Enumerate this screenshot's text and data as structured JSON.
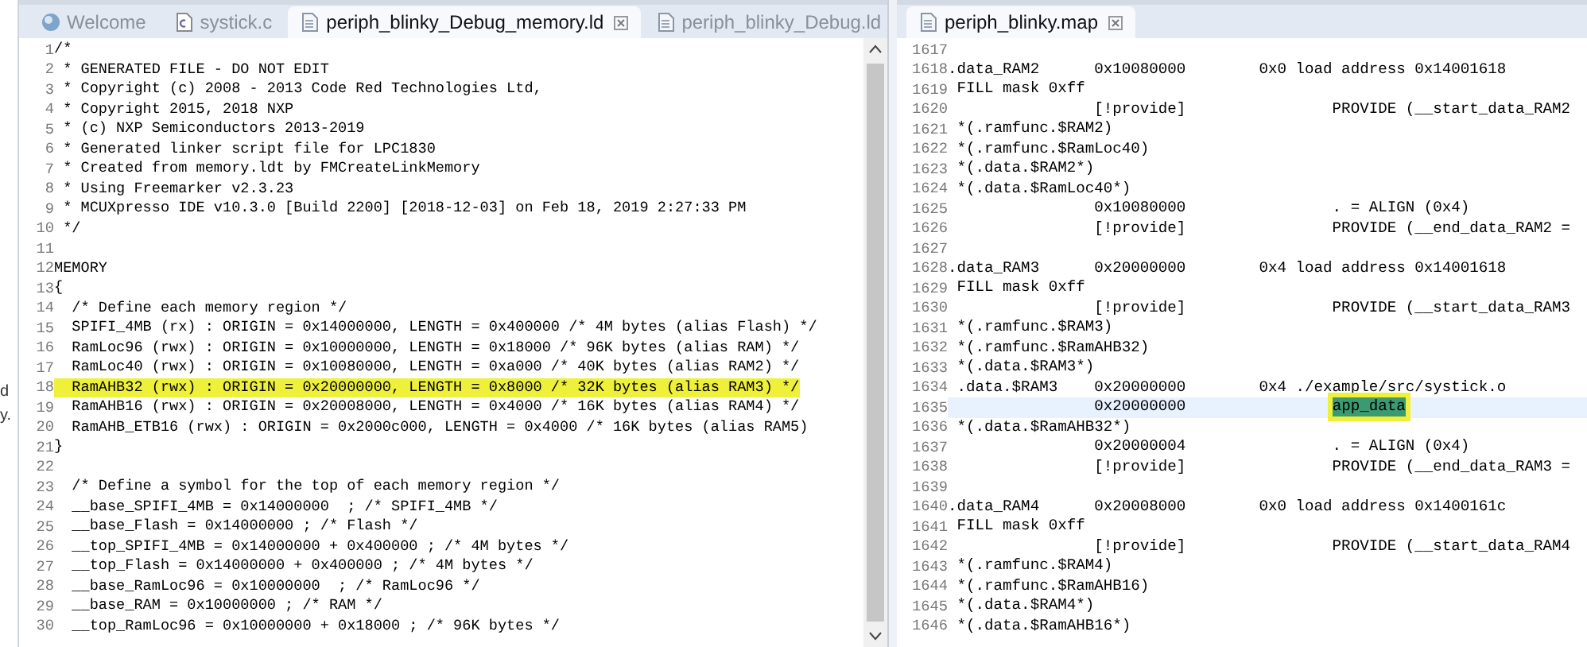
{
  "side_panel": {
    "lines": [
      "d",
      "y."
    ]
  },
  "left_editor": {
    "tabs": [
      {
        "label": "Welcome",
        "kind": "welcome",
        "selected": false,
        "closable": false
      },
      {
        "label": "systick.c",
        "kind": "source",
        "selected": false,
        "closable": false
      },
      {
        "label": "periph_blinky_Debug_memory.ld",
        "kind": "text",
        "selected": true,
        "closable": true
      },
      {
        "label": "periph_blinky_Debug.ld",
        "kind": "text",
        "selected": false,
        "closable": false
      }
    ],
    "lines": [
      {
        "num": "1",
        "text": "/*",
        "highlighted": false
      },
      {
        "num": "2",
        "text": " * GENERATED FILE - DO NOT EDIT",
        "highlighted": false
      },
      {
        "num": "3",
        "text": " * Copyright (c) 2008 - 2013 Code Red Technologies Ltd,",
        "highlighted": false
      },
      {
        "num": "4",
        "text": " * Copyright 2015, 2018 NXP",
        "highlighted": false
      },
      {
        "num": "5",
        "text": " * (c) NXP Semiconductors 2013-2019",
        "highlighted": false
      },
      {
        "num": "6",
        "text": " * Generated linker script file for LPC1830",
        "highlighted": false
      },
      {
        "num": "7",
        "text": " * Created from memory.ldt by FMCreateLinkMemory",
        "highlighted": false
      },
      {
        "num": "8",
        "text": " * Using Freemarker v2.3.23",
        "highlighted": false
      },
      {
        "num": "9",
        "text": " * MCUXpresso IDE v10.3.0 [Build 2200] [2018-12-03] on Feb 18, 2019 2:27:33 PM",
        "highlighted": false
      },
      {
        "num": "10",
        "text": " */",
        "highlighted": false
      },
      {
        "num": "11",
        "highlighted": false
      },
      {
        "num": "12",
        "text": "MEMORY",
        "highlighted": false
      },
      {
        "num": "13",
        "text": "{",
        "highlighted": false
      },
      {
        "num": "14",
        "text": "  /* Define each memory region */",
        "highlighted": false
      },
      {
        "num": "15",
        "text": "  SPIFI_4MB (rx) : ORIGIN = 0x14000000, LENGTH = 0x400000 /* 4M bytes (alias Flash) */",
        "highlighted": false
      },
      {
        "num": "16",
        "text": "  RamLoc96 (rwx) : ORIGIN = 0x10000000, LENGTH = 0x18000 /* 96K bytes (alias RAM) */",
        "highlighted": false
      },
      {
        "num": "17",
        "text": "  RamLoc40 (rwx) : ORIGIN = 0x10080000, LENGTH = 0xa000 /* 40K bytes (alias RAM2) */",
        "highlighted": false
      },
      {
        "num": "18",
        "text": "  RamAHB32 (rwx) : ORIGIN = 0x20000000, LENGTH = 0x8000 /* 32K bytes (alias RAM3) */",
        "highlighted": true
      },
      {
        "num": "19",
        "text": "  RamAHB16 (rwx) : ORIGIN = 0x20008000, LENGTH = 0x4000 /* 16K bytes (alias RAM4) */",
        "highlighted": false
      },
      {
        "num": "20",
        "text": "  RamAHB_ETB16 (rwx) : ORIGIN = 0x2000c000, LENGTH = 0x4000 /* 16K bytes (alias RAM5)",
        "highlighted": false
      },
      {
        "num": "21",
        "text": "}",
        "highlighted": false
      },
      {
        "num": "22",
        "highlighted": false
      },
      {
        "num": "23",
        "text": "  /* Define a symbol for the top of each memory region */",
        "highlighted": false
      },
      {
        "num": "24",
        "text": "  __base_SPIFI_4MB = 0x14000000  ; /* SPIFI_4MB */",
        "highlighted": false
      },
      {
        "num": "25",
        "text": "  __base_Flash = 0x14000000 ; /* Flash */",
        "highlighted": false
      },
      {
        "num": "26",
        "text": "  __top_SPIFI_4MB = 0x14000000 + 0x400000 ; /* 4M bytes */",
        "highlighted": false
      },
      {
        "num": "27",
        "text": "  __top_Flash = 0x14000000 + 0x400000 ; /* 4M bytes */",
        "highlighted": false
      },
      {
        "num": "28",
        "text": "  __base_RamLoc96 = 0x10000000  ; /* RamLoc96 */",
        "highlighted": false
      },
      {
        "num": "29",
        "text": "  __base_RAM = 0x10000000 ; /* RAM */",
        "highlighted": false
      },
      {
        "num": "30",
        "text": "  __top_RamLoc96 = 0x10000000 + 0x18000 ; /* 96K bytes */",
        "highlighted": false
      }
    ]
  },
  "right_editor": {
    "tabs": [
      {
        "label": "periph_blinky.map",
        "kind": "text",
        "selected": true,
        "closable": true
      }
    ],
    "lines": [
      {
        "num": "1617",
        "current": false
      },
      {
        "num": "1618",
        "text": ".data_RAM2      0x10080000        0x0 load address 0x14001618",
        "current": false
      },
      {
        "num": "1619",
        "text": " FILL mask 0xff",
        "current": false
      },
      {
        "num": "1620",
        "text": "                [!provide]                PROVIDE (__start_data_RAM2",
        "current": false
      },
      {
        "num": "1621",
        "text": " *(.ramfunc.$RAM2)",
        "current": false
      },
      {
        "num": "1622",
        "text": " *(.ramfunc.$RamLoc40)",
        "current": false
      },
      {
        "num": "1623",
        "text": " *(.data.$RAM2*)",
        "current": false
      },
      {
        "num": "1624",
        "text": " *(.data.$RamLoc40*)",
        "current": false
      },
      {
        "num": "1625",
        "text": "                0x10080000                . = ALIGN (0x4)",
        "current": false
      },
      {
        "num": "1626",
        "text": "                [!provide]                PROVIDE (__end_data_RAM2 =",
        "current": false
      },
      {
        "num": "1627",
        "current": false
      },
      {
        "num": "1628",
        "text": ".data_RAM3      0x20000000        0x4 load address 0x14001618",
        "current": false
      },
      {
        "num": "1629",
        "text": " FILL mask 0xff",
        "current": false
      },
      {
        "num": "1630",
        "text": "                [!provide]                PROVIDE (__start_data_RAM3",
        "current": false
      },
      {
        "num": "1631",
        "text": " *(.ramfunc.$RAM3)",
        "current": false
      },
      {
        "num": "1632",
        "text": " *(.ramfunc.$RamAHB32)",
        "current": false
      },
      {
        "num": "1633",
        "text": " *(.data.$RAM3*)",
        "current": false
      },
      {
        "num": "1634",
        "text": " .data.$RAM3    0x20000000        0x4 ./example/src/systick.o",
        "current": false
      },
      {
        "num": "1635",
        "text": "                0x20000000                ",
        "highlight": "app_data",
        "current": true
      },
      {
        "num": "1636",
        "text": " *(.data.$RamAHB32*)",
        "current": false
      },
      {
        "num": "1637",
        "text": "                0x20000004                . = ALIGN (0x4)",
        "current": false
      },
      {
        "num": "1638",
        "text": "                [!provide]                PROVIDE (__end_data_RAM3 =",
        "current": false
      },
      {
        "num": "1639",
        "current": false
      },
      {
        "num": "1640",
        "text": ".data_RAM4      0x20008000        0x0 load address 0x1400161c",
        "current": false
      },
      {
        "num": "1641",
        "text": " FILL mask 0xff",
        "current": false
      },
      {
        "num": "1642",
        "text": "                [!provide]                PROVIDE (__start_data_RAM4",
        "current": false
      },
      {
        "num": "1643",
        "text": " *(.ramfunc.$RAM4)",
        "current": false
      },
      {
        "num": "1644",
        "text": " *(.ramfunc.$RamAHB16)",
        "current": false
      },
      {
        "num": "1645",
        "text": " *(.data.$RAM4*)",
        "current": false
      },
      {
        "num": "1646",
        "text": " *(.data.$RamAHB16*)",
        "current": false
      }
    ]
  }
}
